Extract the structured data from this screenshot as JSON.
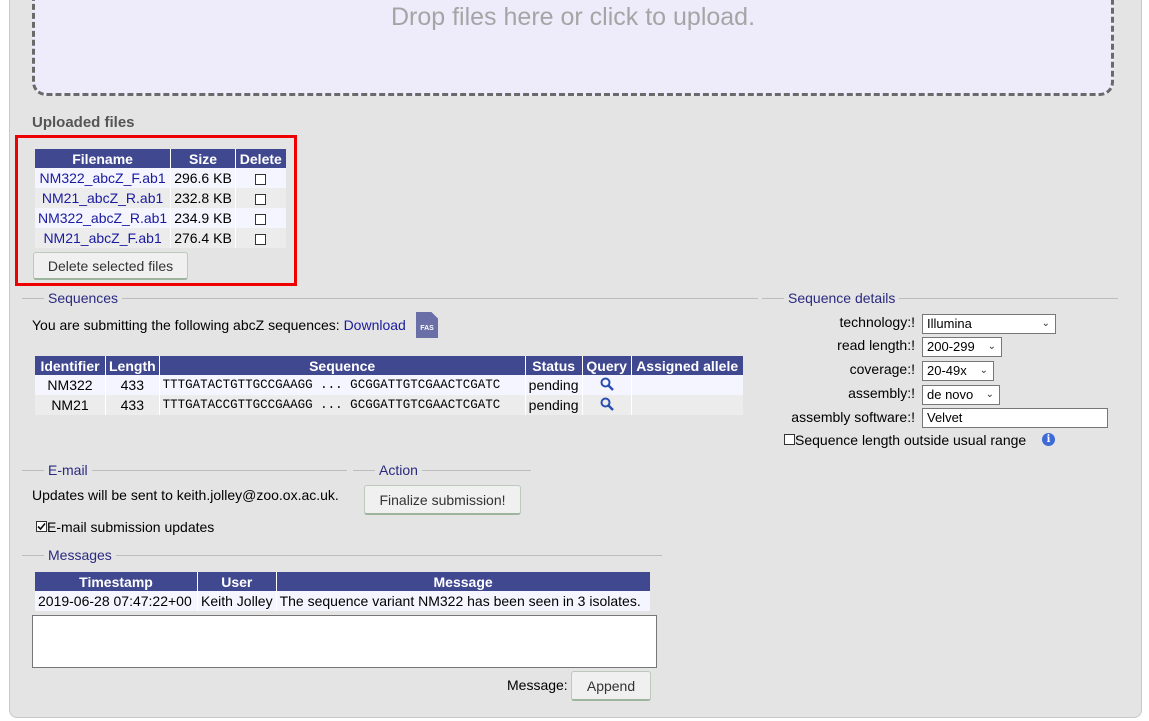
{
  "dropzone": {
    "text": "Drop files here or click to upload."
  },
  "uploaded": {
    "heading": "Uploaded files",
    "columns": [
      "Filename",
      "Size",
      "Delete"
    ],
    "files": [
      {
        "name": "NM322_abcZ_F.ab1",
        "size": "296.6 KB"
      },
      {
        "name": "NM21_abcZ_R.ab1",
        "size": "232.8 KB"
      },
      {
        "name": "NM322_abcZ_R.ab1",
        "size": "234.9 KB"
      },
      {
        "name": "NM21_abcZ_F.ab1",
        "size": "276.4 KB"
      }
    ],
    "delete_button": "Delete selected files"
  },
  "sequences": {
    "legend": "Sequences",
    "intro": "You are submitting the following abcZ sequences:",
    "download_link": "Download",
    "download_icon": "FAS",
    "columns": [
      "Identifier",
      "Length",
      "Sequence",
      "Status",
      "Query",
      "Assigned allele"
    ],
    "rows": [
      {
        "identifier": "NM322",
        "length": "433",
        "sequence": "TTTGATACTGTTGCCGAAGG ... GCGGATTGTCGAACTCGATC",
        "status": "pending",
        "assigned": ""
      },
      {
        "identifier": "NM21",
        "length": "433",
        "sequence": "TTTGATACCGTTGCCGAAGG ... GCGGATTGTCGAACTCGATC",
        "status": "pending",
        "assigned": ""
      }
    ]
  },
  "details": {
    "legend": "Sequence details",
    "technology_label": "technology:!",
    "technology_value": "Illumina",
    "read_length_label": "read length:!",
    "read_length_value": "200-299",
    "coverage_label": "coverage:!",
    "coverage_value": "20-49x",
    "assembly_label": "assembly:!",
    "assembly_value": "de novo",
    "software_label": "assembly software:!",
    "software_value": "Velvet",
    "outside_range_label": "Sequence length outside usual range",
    "outside_range_checked": false
  },
  "email": {
    "legend": "E-mail",
    "text": "Updates will be sent to keith.jolley@zoo.ox.ac.uk.",
    "checkbox_label": "E-mail submission updates",
    "checked": true
  },
  "action": {
    "legend": "Action",
    "finalize_button": "Finalize submission!"
  },
  "messages": {
    "legend": "Messages",
    "columns": [
      "Timestamp",
      "User",
      "Message"
    ],
    "rows": [
      {
        "timestamp": "2019-06-28 07:47:22+00",
        "user": "Keith Jolley",
        "message": "The sequence variant NM322 has been seen in 3 isolates."
      }
    ],
    "input_label": "Message:",
    "append_button": "Append"
  }
}
